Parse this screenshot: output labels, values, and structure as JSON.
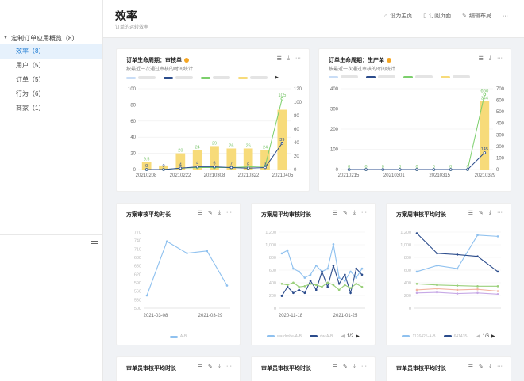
{
  "sidebar": {
    "group_label": "定制订单应用概览（8）",
    "items": [
      {
        "label": "效率（8）",
        "active": true
      },
      {
        "label": "用户（5）",
        "active": false
      },
      {
        "label": "订单（5）",
        "active": false
      },
      {
        "label": "行为（6）",
        "active": false
      },
      {
        "label": "商家（1）",
        "active": false
      }
    ]
  },
  "header": {
    "title": "效率",
    "subtitle": "订单的运转效率",
    "actions": {
      "set_home": "设为主页",
      "subscribe": "订阅页面",
      "edit_layout": "编辑布局",
      "more": "···"
    }
  },
  "tools": {
    "more": "···"
  },
  "colors": {
    "bar": "#f7db7a",
    "green": "#7ccf6c",
    "navy": "#2b4c8c",
    "blue": "#78b0e6",
    "lightblue": "#8fc1ef",
    "accent": "#1677d2"
  },
  "chart_data": [
    {
      "type": "bar+line",
      "title": "订单生命周期：审核单",
      "subtitle": "按最近一次通过审核的时间统计",
      "x_ticks": [
        "20210208",
        "20210222",
        "20210308",
        "20210322",
        "20210405"
      ],
      "bar_values": [
        9.5,
        5,
        20,
        24,
        29,
        26,
        26,
        24,
        74
      ],
      "bar_labels": [
        "9.5",
        "",
        "20",
        "24",
        "29",
        "26",
        "26",
        "24",
        ""
      ],
      "green_values": [
        0,
        0,
        2,
        3,
        3,
        3,
        4,
        5,
        105
      ],
      "green_labels": [
        "",
        "",
        "",
        "",
        "",
        "",
        "",
        "",
        "105"
      ],
      "navy_values": [
        0,
        0,
        2,
        4,
        4,
        3,
        2,
        3,
        39
      ],
      "navy_labels": [
        "0",
        "0",
        "4",
        "4",
        "6",
        "7",
        "5",
        "3",
        "39"
      ],
      "y_left_ticks": [
        "0",
        "20",
        "40",
        "60",
        "80",
        "100"
      ],
      "y_right_ticks": [
        "0",
        "20",
        "40",
        "60",
        "80",
        "100",
        "120"
      ],
      "ylim": [
        0,
        100
      ]
    },
    {
      "type": "bar+line",
      "title": "订单生命周期：生产单",
      "subtitle": "按最近一次通过审核的时间统计",
      "x_ticks": [
        "20210215",
        "20210301",
        "20210315",
        "20210329"
      ],
      "bar_values": [
        0,
        0,
        0,
        0,
        0,
        0,
        0,
        0,
        340
      ],
      "bar_labels": [
        "0",
        "0",
        "0",
        "0",
        "0",
        "0",
        "0",
        "0",
        "344"
      ],
      "green_values": [
        0,
        0,
        0,
        0,
        0,
        0,
        0,
        0,
        650
      ],
      "green_labels": [
        "",
        "",
        "",
        "",
        "",
        "",
        "",
        "",
        "650"
      ],
      "navy_values": [
        0,
        0,
        0,
        0,
        0,
        0,
        0,
        0,
        145
      ],
      "navy_labels": [
        "",
        "",
        "",
        "",
        "",
        "",
        "",
        "",
        "145"
      ],
      "y_left_ticks": [
        "0",
        "100",
        "200",
        "300",
        "400"
      ],
      "y_right_ticks": [
        "0",
        "100",
        "200",
        "300",
        "400",
        "500",
        "600",
        "700"
      ],
      "ylim": [
        0,
        400
      ]
    },
    {
      "type": "line",
      "title": "方案审核平均时长",
      "x_ticks": [
        "2021-03-08",
        "2021-03-29"
      ],
      "y_ticks": [
        "500",
        "530",
        "560",
        "590",
        "620",
        "650",
        "680",
        "710",
        "740",
        "770"
      ],
      "ylim": [
        500,
        770
      ],
      "series": [
        {
          "name": "A-B",
          "values": [
            545,
            737,
            695,
            703,
            580
          ]
        }
      ]
    },
    {
      "type": "line",
      "title": "方案周平均审核时长",
      "x_ticks": [
        "2020-11-18",
        "2021-01-25"
      ],
      "y_ticks": [
        "0",
        "200",
        "400",
        "600",
        "800",
        "1,000",
        "1,200"
      ],
      "ylim": [
        0,
        1250
      ],
      "series": [
        {
          "name": "wardrobe-A-B",
          "values": [
            900,
            950,
            650,
            600,
            500,
            550,
            700,
            600,
            650,
            1050,
            500,
            450,
            600,
            500,
            650
          ]
        },
        {
          "name": "dw-A-B",
          "values": [
            200,
            350,
            250,
            300,
            250,
            450,
            300,
            600,
            350,
            700,
            400,
            550,
            250,
            650,
            550
          ]
        },
        {
          "name": "",
          "values": [
            400,
            380,
            420,
            350,
            360,
            400,
            380,
            350,
            420,
            380,
            300,
            380,
            330,
            400,
            350
          ]
        }
      ],
      "pager": "1/2"
    },
    {
      "type": "line",
      "title": "方案周审核平均时长",
      "y_ticks": [
        "0",
        "200",
        "400",
        "600",
        "800",
        "1,000",
        "1,200"
      ],
      "ylim": [
        0,
        1250
      ],
      "series": [
        {
          "name": "1126425-A-B",
          "values": [
            600,
            700,
            650,
            1200,
            1180
          ]
        },
        {
          "name": "641435-",
          "values": [
            1230,
            900,
            880,
            850,
            600
          ]
        },
        {
          "name": "",
          "values": [
            400,
            380,
            370,
            360,
            360
          ]
        },
        {
          "name": "",
          "values": [
            300,
            320,
            300,
            310,
            280
          ]
        },
        {
          "name": "",
          "values": [
            250,
            260,
            240,
            250,
            230
          ]
        }
      ],
      "pager": "1/6"
    }
  ],
  "bottom_cards": [
    {
      "title": "审单员审核平均时长"
    },
    {
      "title": "审单员审核平均时长"
    },
    {
      "title": "审单员审核平均时长"
    }
  ]
}
